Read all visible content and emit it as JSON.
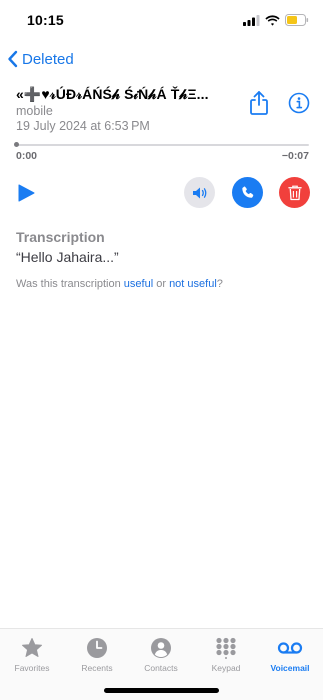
{
  "status_bar": {
    "time": "10:15"
  },
  "nav": {
    "back_label": "Deleted"
  },
  "voicemail": {
    "caller_name": "«➕♥︎𝓇ÚĐ𝓇ÁŃŚ𝒽 Ś𝒾Ń𝒽Á Ť𝒽Ξ...",
    "caller_type": "mobile",
    "date": "19 July 2024 at 6:53 PM",
    "time_elapsed": "0:00",
    "time_remaining": "−0:07",
    "progress": 0
  },
  "transcription": {
    "title": "Transcription",
    "text": "“Hello Jahaira...”",
    "feedback_prefix": "Was this transcription ",
    "useful_label": "useful",
    "feedback_or": " or ",
    "not_useful_label": "not useful",
    "feedback_suffix": "?"
  },
  "tab_bar": {
    "items": [
      {
        "label": "Favorites",
        "icon": "star-icon",
        "active": false
      },
      {
        "label": "Recents",
        "icon": "clock-icon",
        "active": false
      },
      {
        "label": "Contacts",
        "icon": "person-circle-icon",
        "active": false
      },
      {
        "label": "Keypad",
        "icon": "keypad-icon",
        "active": false
      },
      {
        "label": "Voicemail",
        "icon": "voicemail-icon",
        "active": true
      }
    ]
  },
  "colors": {
    "accent": "#1a7cf2",
    "delete": "#f1403c",
    "secondary_text": "#8a8a8e",
    "battery": "#f5c518"
  }
}
